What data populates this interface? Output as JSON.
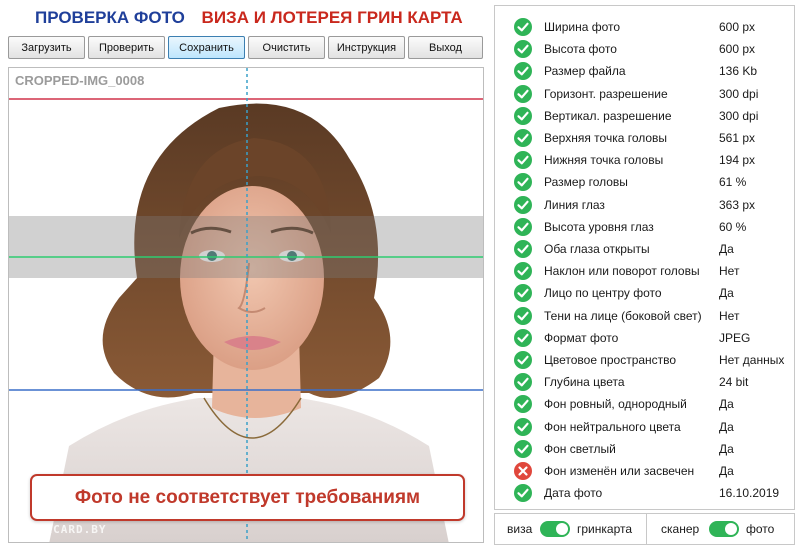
{
  "header": {
    "title_part1": "ПРОВЕРКА ФОТО",
    "title_part2": "ВИЗА И ЛОТЕРЕЯ ГРИН КАРТА"
  },
  "toolbar": {
    "load": "Загрузить",
    "check": "Проверить",
    "save": "Сохранить",
    "clear": "Очистить",
    "instruction": "Инструкция",
    "exit": "Выход"
  },
  "photo": {
    "file_name": "CROPPED-IMG_0008",
    "watermark": "GREENCARD.BY",
    "result": "Фото не соответствует требованиям"
  },
  "checks": [
    {
      "label": "Ширина фото",
      "value": "600 px",
      "status": "ok"
    },
    {
      "label": "Высота фото",
      "value": "600 px",
      "status": "ok"
    },
    {
      "label": "Размер файла",
      "value": "136 Kb",
      "status": "ok"
    },
    {
      "label": "Горизонт. разрешение",
      "value": "300 dpi",
      "status": "ok"
    },
    {
      "label": "Вертикал. разрешение",
      "value": "300 dpi",
      "status": "ok"
    },
    {
      "label": "Верхняя точка головы",
      "value": "561 px",
      "status": "ok"
    },
    {
      "label": "Нижняя точка головы",
      "value": "194 px",
      "status": "ok"
    },
    {
      "label": "Размер головы",
      "value": "61 %",
      "status": "ok"
    },
    {
      "label": "Линия глаз",
      "value": "363 px",
      "status": "ok"
    },
    {
      "label": "Высота уровня глаз",
      "value": "60 %",
      "status": "ok"
    },
    {
      "label": "Оба глаза открыты",
      "value": "Да",
      "status": "ok"
    },
    {
      "label": "Наклон или поворот головы",
      "value": "Нет",
      "status": "ok"
    },
    {
      "label": "Лицо по центру фото",
      "value": "Да",
      "status": "ok"
    },
    {
      "label": "Тени на лице (боковой свет)",
      "value": "Нет",
      "status": "ok"
    },
    {
      "label": "Формат фото",
      "value": "JPEG",
      "status": "ok"
    },
    {
      "label": "Цветовое пространство",
      "value": "Нет данных",
      "status": "ok"
    },
    {
      "label": "Глубина цвета",
      "value": "24 bit",
      "status": "ok"
    },
    {
      "label": "Фон ровный, однородный",
      "value": "Да",
      "status": "ok"
    },
    {
      "label": "Фон нейтрального цвета",
      "value": "Да",
      "status": "ok"
    },
    {
      "label": "Фон светлый",
      "value": "Да",
      "status": "ok"
    },
    {
      "label": "Фон изменён или засвечен",
      "value": "Да",
      "status": "fail"
    },
    {
      "label": "Дата фото",
      "value": "16.10.2019",
      "status": "ok"
    }
  ],
  "toggles": {
    "mode_left": "виза",
    "mode_right": "гринкарта",
    "source_left": "сканер",
    "source_right": "фото",
    "mode_state": "гринкарта",
    "source_state": "фото"
  },
  "colors": {
    "ok": "#2fb457",
    "fail": "#e0473c",
    "title_blue": "#1f3f9a",
    "title_red": "#c9281d",
    "guide_red": "#d0324a",
    "guide_green": "#2ecc71",
    "guide_blue": "#3a6fc9",
    "guide_center": "#3aa0c8"
  }
}
